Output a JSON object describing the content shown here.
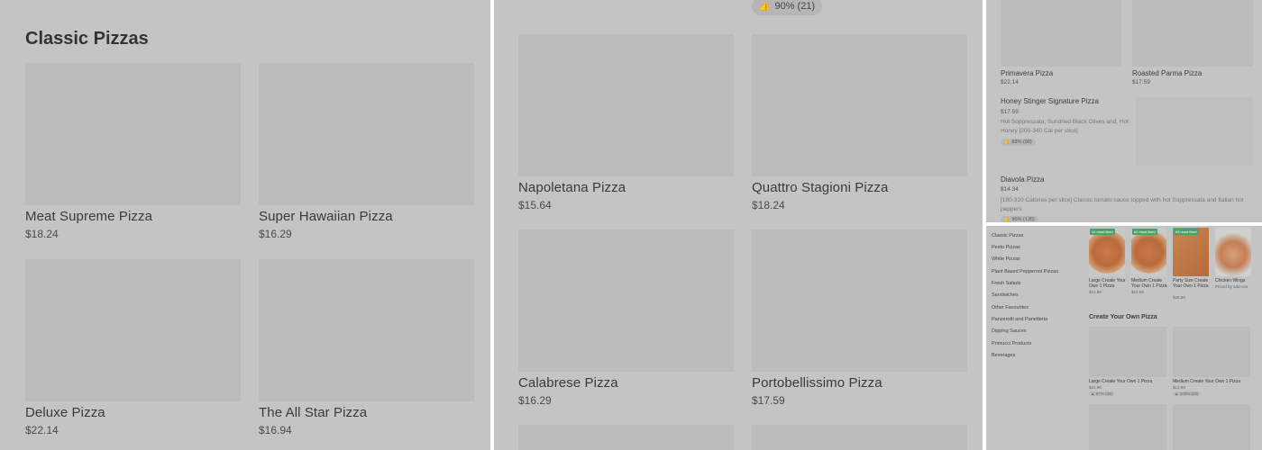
{
  "panel1": {
    "section_title": "Classic Pizzas",
    "items": [
      {
        "name": "Meat Supreme Pizza",
        "price": "$18.24"
      },
      {
        "name": "Super Hawaiian Pizza",
        "price": "$16.29"
      },
      {
        "name": "Deluxe Pizza",
        "price": "$22.14"
      },
      {
        "name": "The All Star Pizza",
        "price": "$16.94"
      }
    ]
  },
  "panel2": {
    "rating": "90% (21)",
    "items": [
      {
        "name": "Napoletana Pizza",
        "price": "$15.64"
      },
      {
        "name": "Quattro Stagioni Pizza",
        "price": "$18.24"
      },
      {
        "name": "Calabrese Pizza",
        "price": "$16.29"
      },
      {
        "name": "Portobellissimo Pizza",
        "price": "$17.59"
      }
    ]
  },
  "panel3": {
    "items": [
      {
        "name": "Primavera Pizza",
        "price": "$22.14"
      },
      {
        "name": "Roasted Parma Pizza",
        "price": "$17.59"
      }
    ],
    "featured": {
      "name": "Honey Stinger Signature Pizza",
      "price": "$17.59",
      "description": "Hot Soppressata, Sundried Black Olives and, Hot Honey [200-340 Cal per slice]",
      "rating": "88% (98)"
    },
    "diavola": {
      "name": "Diavola Pizza",
      "price": "$14.34",
      "description": "[180-310 Calories per slice] Classic tomato sauce topped with hot Soppressata and Italian hot peppers",
      "rating": "96% (130)"
    }
  },
  "panel4": {
    "sidebar": [
      "Classic Pizzas",
      "Pesto Pizzas",
      "White Pizzas",
      "Plant Based Pepperoni Pizzas",
      "Fresh Salads",
      "Sandwiches",
      "Other Favourites",
      "Panzerotti and Panetteria",
      "Dipping Sauces",
      "Primucci Products",
      "Beverages"
    ],
    "top_items": [
      {
        "badge": "#1 most liked",
        "name": "Large Create Your Own 1 Pizza",
        "price": "$21.99"
      },
      {
        "badge": "#2 most liked",
        "name": "Medium Create Your Own 1 Pizza",
        "price": "$12.99"
      },
      {
        "badge": "#3 most liked",
        "name": "Party Size Create Your Own 1 Pizza",
        "price": "$28.99"
      },
      {
        "badge": "",
        "name": "Chicken Wings",
        "price": "Priced by add-ons"
      }
    ],
    "section_title": "Create Your Own Pizza",
    "cyo_items": [
      {
        "name": "Large Create Your Own 1 Pizza",
        "price": "$21.99",
        "rating": "87% (38)"
      },
      {
        "name": "Medium Create Your Own 1 Pizza",
        "price": "$12.99",
        "rating": "100% (22)"
      }
    ]
  }
}
